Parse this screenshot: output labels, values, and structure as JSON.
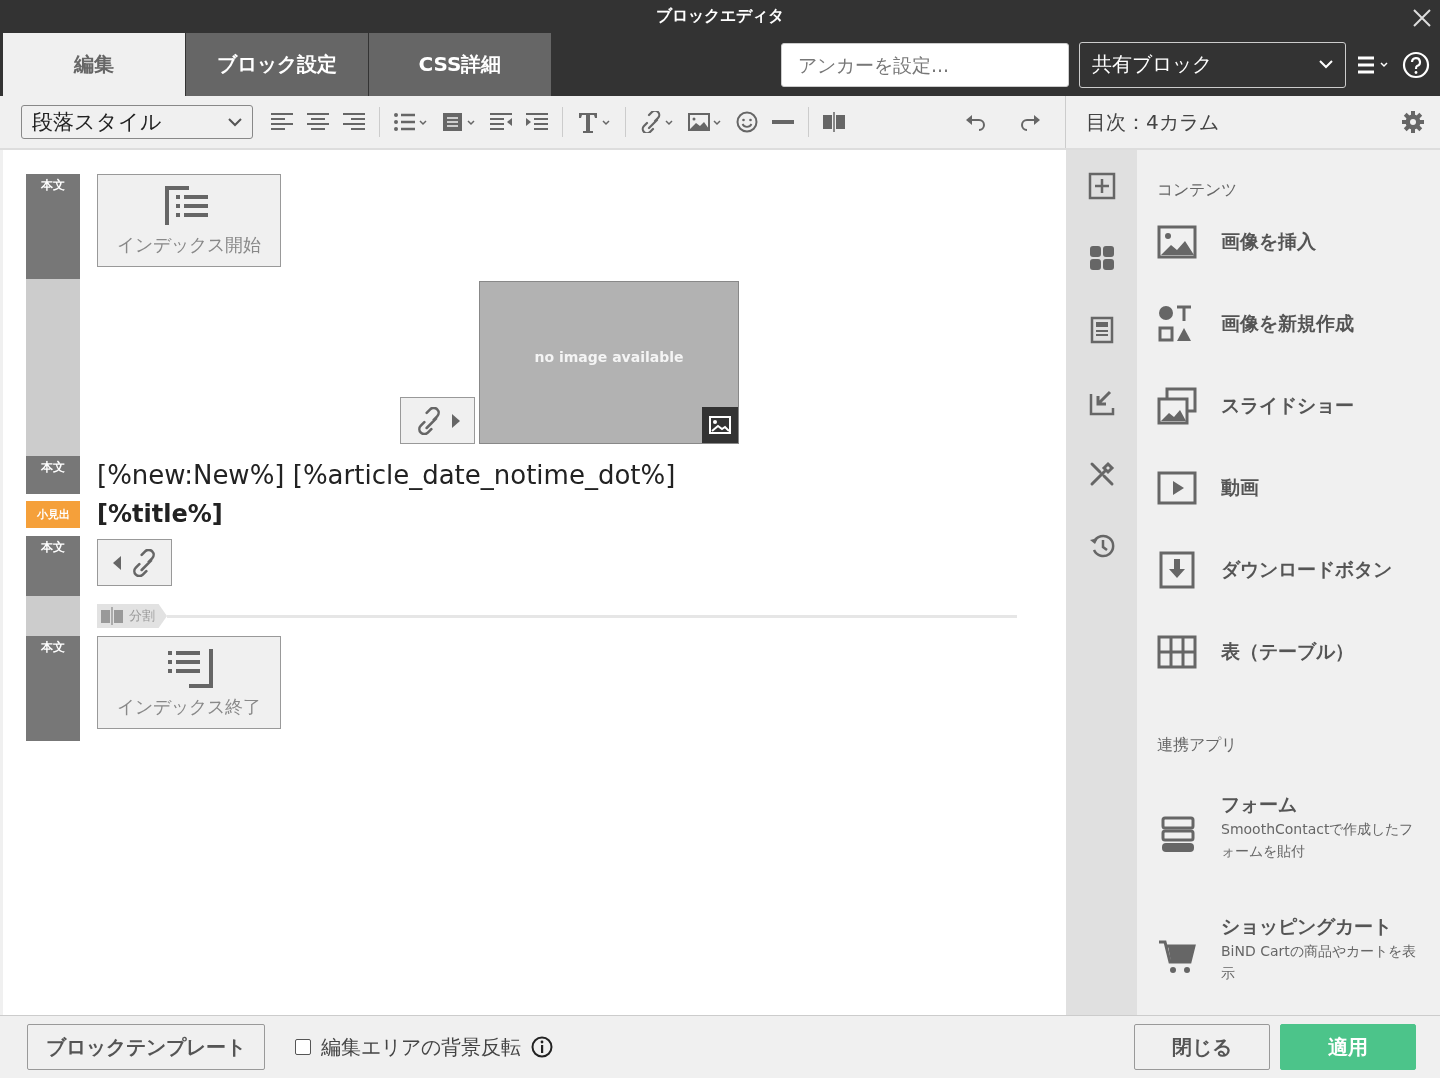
{
  "window": {
    "title": "ブロックエディタ"
  },
  "tabs": [
    {
      "label": "編集",
      "selected": true
    },
    {
      "label": "ブロック設定",
      "selected": false
    },
    {
      "label": "CSS詳細",
      "selected": false
    }
  ],
  "anchor_field": {
    "placeholder": "アンカーを設定..."
  },
  "shared_block_select": {
    "value": "共有ブロック"
  },
  "toolbar": {
    "paragraph_style": "段落スタイル"
  },
  "side_header": {
    "title": "目次：4カラム"
  },
  "blocks": [
    {
      "kind": "index_start",
      "color": "#777777",
      "label": "本文",
      "text": "インデックス開始"
    },
    {
      "kind": "image",
      "color": "#cccccc",
      "text": "no image available"
    },
    {
      "kind": "text",
      "color": "#777777",
      "label": "本文",
      "text": "[%new:New%] [%article_date_notime_dot%]"
    },
    {
      "kind": "heading",
      "color": "#f5a03a",
      "label": "小見出",
      "text": "[%title%]"
    },
    {
      "kind": "link_back",
      "color": "#777777",
      "label": "本文"
    },
    {
      "kind": "divider",
      "color": "#cccccc",
      "text": "分割"
    },
    {
      "kind": "index_end",
      "color": "#777777",
      "label": "本文",
      "text": "インデックス終了"
    }
  ],
  "panel": {
    "sections": [
      {
        "title": "コンテンツ",
        "items": [
          {
            "title": "画像を挿入"
          },
          {
            "title": "画像を新規作成"
          },
          {
            "title": "スライドショー"
          },
          {
            "title": "動画"
          },
          {
            "title": "ダウンロードボタン"
          },
          {
            "title": "表（テーブル）"
          }
        ]
      },
      {
        "title": "連携アプリ",
        "items": [
          {
            "title": "フォーム",
            "description": "SmoothContactで作成したフォームを貼付"
          },
          {
            "title": "ショッピングカート",
            "description": "BiND Cartの商品やカートを表示"
          }
        ]
      }
    ]
  },
  "footer": {
    "template_button": "ブロックテンプレート",
    "invert_background": {
      "label": "編集エリアの背景反転",
      "checked": false
    },
    "close_button": "閉じる",
    "apply_button": "適用"
  }
}
